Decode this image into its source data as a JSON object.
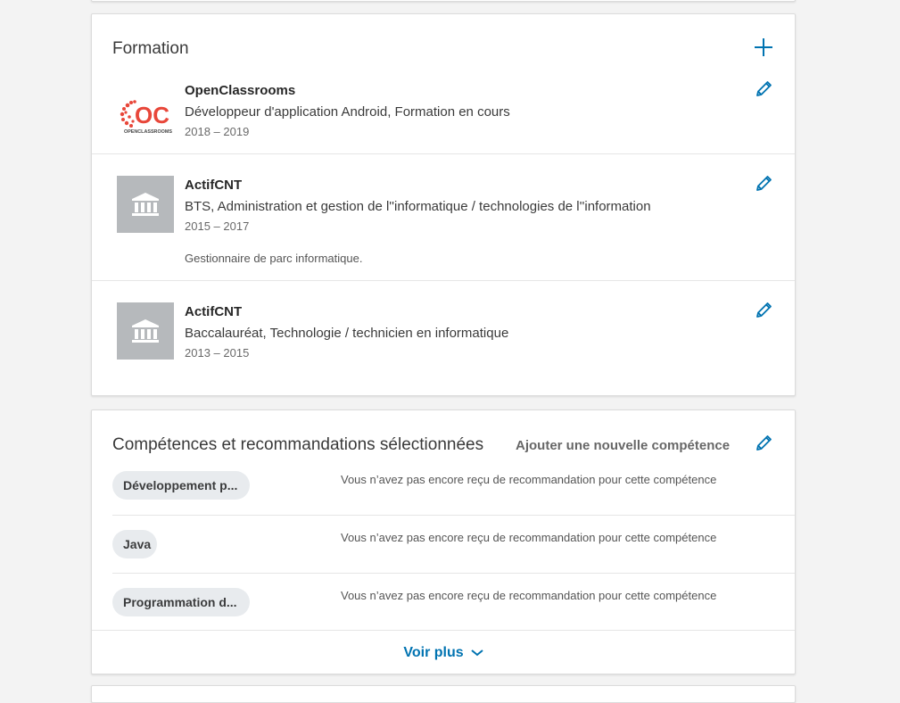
{
  "education": {
    "title": "Formation",
    "add_icon": "plus-icon",
    "edit_icon": "pencil-icon",
    "items": [
      {
        "school": "OpenClassrooms",
        "degree": "Développeur d'application Android, Formation en cours",
        "dates": "2018 – 2019",
        "logo": "openclassrooms-logo",
        "logo_text": "OC",
        "logo_subtext": "OPENCLASSROOMS"
      },
      {
        "school": "ActifCNT",
        "degree": "BTS, Administration et gestion de l''informatique / technologies de l''information",
        "dates": "2015 – 2017",
        "description": "Gestionnaire de parc informatique.",
        "logo": "school-building-icon"
      },
      {
        "school": "ActifCNT",
        "degree": "Baccalauréat, Technologie / technicien en informatique",
        "dates": "2013 – 2015",
        "logo": "school-building-icon"
      }
    ]
  },
  "skills": {
    "title": "Compétences et recommandations sélectionnées",
    "add_skill_label": "Ajouter une nouvelle compétence",
    "items": [
      {
        "name": "Développement p...",
        "endorsement": "Vous n’avez pas encore reçu de recommandation pour cette compétence"
      },
      {
        "name": "Java",
        "endorsement": "Vous n’avez pas encore reçu de recommandation pour cette compétence"
      },
      {
        "name": "Programmation d...",
        "endorsement": "Vous n’avez pas encore reçu de recommandation pour cette compétence"
      }
    ],
    "see_more_label": "Voir plus"
  },
  "colors": {
    "accent": "#0073b1",
    "background": "#f3f3f3",
    "pill": "#e8ebee",
    "placeholder_logo": "#b6b9bc"
  }
}
